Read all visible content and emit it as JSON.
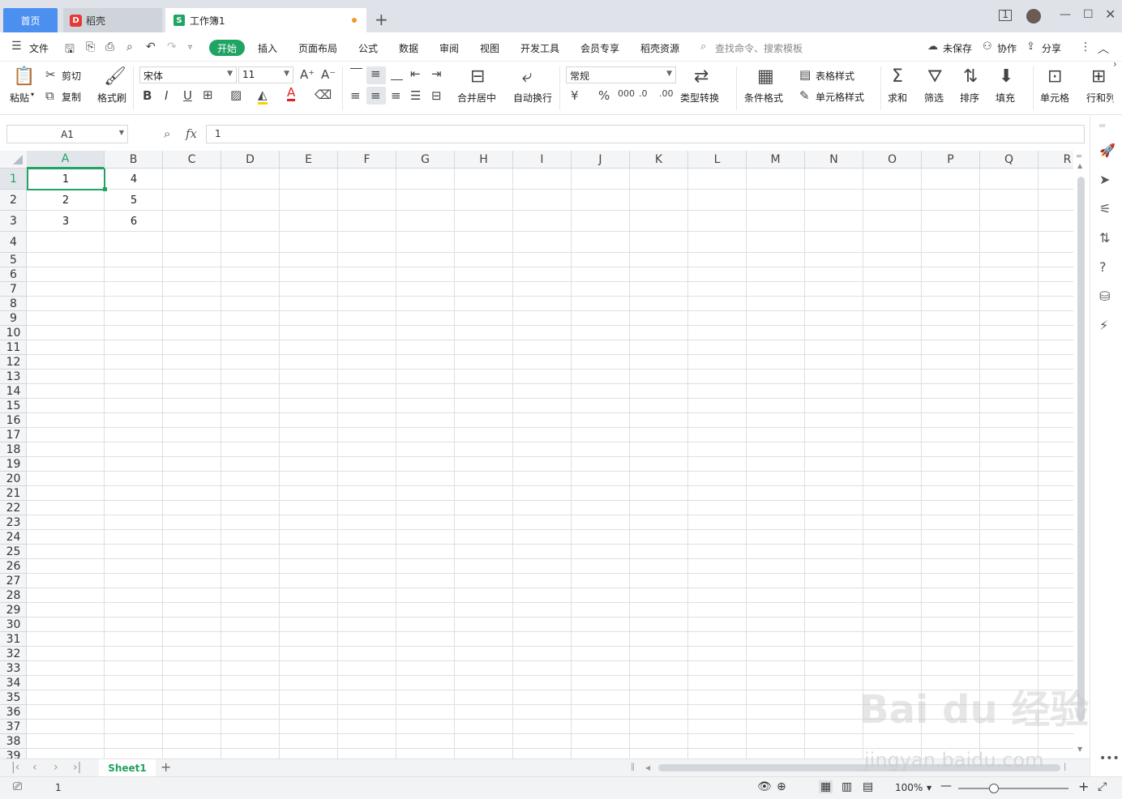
{
  "tabs": {
    "home": "首页",
    "daoke": "稻壳",
    "workbook": "工作簿1"
  },
  "menu": {
    "file": "文件",
    "start": "开始",
    "items": [
      "插入",
      "页面布局",
      "公式",
      "数据",
      "审阅",
      "视图",
      "开发工具",
      "会员专享",
      "稻壳资源"
    ],
    "search": "查找命令、搜索模板",
    "unsaved": "未保存",
    "collab": "协作",
    "share": "分享"
  },
  "ribbon": {
    "paste": "粘贴",
    "cut": "剪切",
    "copy": "复制",
    "format_painter": "格式刷",
    "font_name": "宋体",
    "font_size": "11",
    "merge": "合并居中",
    "wrap": "自动换行",
    "number_format": "常规",
    "type_convert": "类型转换",
    "cond_format": "条件格式",
    "table_style": "表格样式",
    "cell_style": "单元格样式",
    "sum": "求和",
    "filter": "筛选",
    "sort": "排序",
    "fill": "填充",
    "cell": "单元格",
    "rowcol": "行和列"
  },
  "formula": {
    "name_box": "A1",
    "fx": "fx",
    "value": "1"
  },
  "columns": [
    "A",
    "B",
    "C",
    "D",
    "E",
    "F",
    "G",
    "H",
    "I",
    "J",
    "K",
    "L",
    "M",
    "N",
    "O",
    "P",
    "Q",
    "R"
  ],
  "rows": [
    "1",
    "2",
    "3",
    "4",
    "5",
    "6",
    "7",
    "8",
    "9",
    "10",
    "11",
    "12",
    "13",
    "14",
    "15",
    "16",
    "17",
    "18",
    "19",
    "20",
    "21",
    "22",
    "23",
    "24",
    "25",
    "26",
    "27",
    "28",
    "29",
    "30",
    "31",
    "32",
    "33",
    "34",
    "35",
    "36",
    "37",
    "38",
    "39"
  ],
  "cells": {
    "A1": "1",
    "A2": "2",
    "A3": "3",
    "B1": "4",
    "B2": "5",
    "B3": "6"
  },
  "sheet": {
    "name": "Sheet1"
  },
  "status": {
    "value": "1",
    "zoom": "100%",
    "zoom_level": 100
  },
  "watermark": {
    "line1": "Bai du 经验",
    "line2": "jingyan.baidu.com"
  },
  "colors": {
    "accent": "#1fa463",
    "tab_blue": "#4b8ff0"
  }
}
